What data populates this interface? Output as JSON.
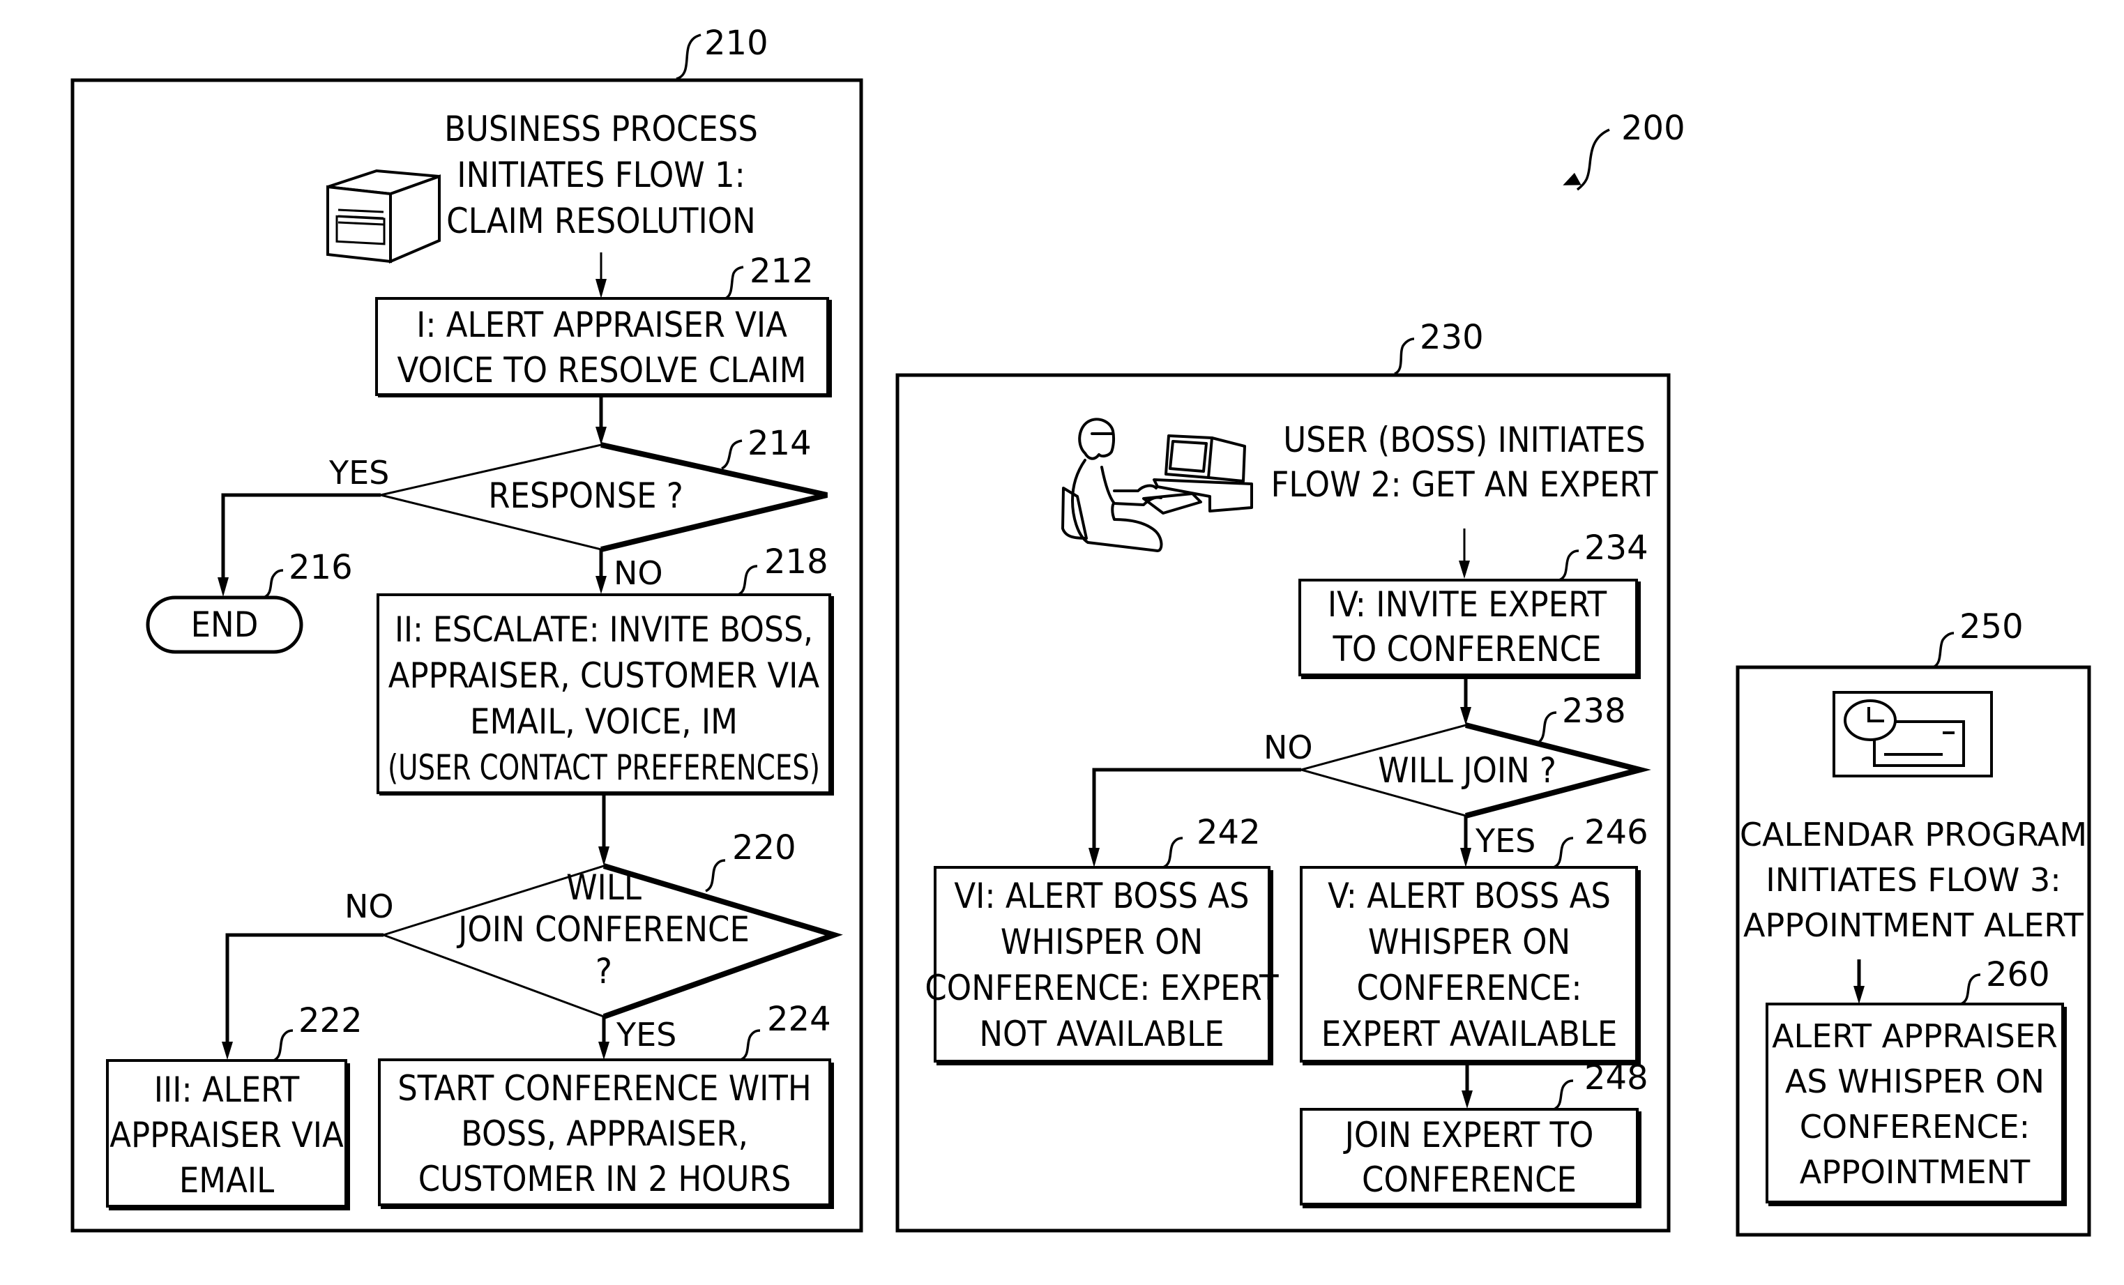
{
  "figure": {
    "ref": "200"
  },
  "flow1": {
    "ref": "210",
    "source_icon": "server-icon",
    "title_lines": [
      "BUSINESS PROCESS",
      "INITIATES FLOW 1:",
      "CLAIM RESOLUTION"
    ],
    "step212": {
      "ref": "212",
      "lines": [
        "I: ALERT APPRAISER VIA",
        "VOICE TO RESOLVE CLAIM"
      ]
    },
    "decision214": {
      "ref": "214",
      "text": "RESPONSE ?",
      "yes": "YES",
      "no": "NO"
    },
    "end216": {
      "ref": "216",
      "text": "END"
    },
    "step218": {
      "ref": "218",
      "lines": [
        "II: ESCALATE: INVITE BOSS,",
        "APPRAISER, CUSTOMER VIA",
        "EMAIL, VOICE, IM",
        "(USER CONTACT PREFERENCES)"
      ]
    },
    "decision220": {
      "ref": "220",
      "lines": [
        "WILL",
        "JOIN CONFERENCE",
        "?"
      ],
      "yes": "YES",
      "no": "NO"
    },
    "step222": {
      "ref": "222",
      "lines": [
        "III: ALERT",
        "APPRAISER VIA",
        "EMAIL"
      ]
    },
    "step224": {
      "ref": "224",
      "lines": [
        "START CONFERENCE WITH",
        "BOSS, APPRAISER,",
        "CUSTOMER IN 2 HOURS"
      ]
    }
  },
  "flow2": {
    "ref": "230",
    "source_icon": "user-at-computer-icon",
    "title_lines": [
      "USER (BOSS) INITIATES",
      "FLOW 2: GET AN EXPERT"
    ],
    "step234": {
      "ref": "234",
      "lines": [
        "IV: INVITE EXPERT",
        "TO CONFERENCE"
      ]
    },
    "decision238": {
      "ref": "238",
      "text": "WILL JOIN ?",
      "yes": "YES",
      "no": "NO"
    },
    "step242": {
      "ref": "242",
      "lines": [
        "VI: ALERT BOSS AS",
        "WHISPER ON",
        "CONFERENCE: EXPERT",
        "NOT AVAILABLE"
      ]
    },
    "step246": {
      "ref": "246",
      "lines": [
        "V: ALERT BOSS AS",
        "WHISPER ON",
        "CONFERENCE:",
        "EXPERT AVAILABLE"
      ]
    },
    "step248": {
      "ref": "248",
      "lines": [
        "JOIN EXPERT TO",
        "CONFERENCE"
      ]
    }
  },
  "flow3": {
    "ref": "250",
    "source_icon": "calendar-clock-icon",
    "title_lines": [
      "CALENDAR PROGRAM",
      "INITIATES FLOW 3:",
      "APPOINTMENT ALERT"
    ],
    "step260": {
      "ref": "260",
      "lines": [
        "ALERT APPRAISER",
        "AS WHISPER ON",
        "CONFERENCE:",
        "APPOINTMENT"
      ]
    }
  }
}
